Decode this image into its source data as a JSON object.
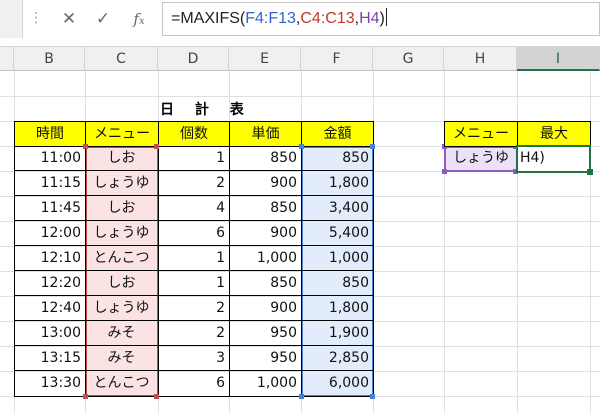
{
  "formula_bar": {
    "cancel_icon": "x-icon",
    "enter_icon": "check-icon",
    "function_icon": "fx-icon",
    "formula_prefix": "=MAXIFS(",
    "arg1": "F4:F13",
    "sep1": ",",
    "arg2": "C4:C13",
    "sep2": ",",
    "arg3": "H4",
    "suffix": ")"
  },
  "columns": [
    "B",
    "C",
    "D",
    "E",
    "F",
    "G",
    "H",
    "I"
  ],
  "selected_column": "I",
  "sheet": {
    "title": "日 計 表",
    "headers": [
      "時間",
      "メニュー",
      "個数",
      "単価",
      "金額"
    ],
    "rows": [
      [
        "11:00",
        "しお",
        "1",
        "850",
        "850"
      ],
      [
        "11:15",
        "しょうゆ",
        "2",
        "900",
        "1,800"
      ],
      [
        "11:45",
        "しお",
        "4",
        "850",
        "3,400"
      ],
      [
        "12:00",
        "しょうゆ",
        "6",
        "900",
        "5,400"
      ],
      [
        "12:10",
        "とんこつ",
        "1",
        "1,000",
        "1,000"
      ],
      [
        "12:20",
        "しお",
        "1",
        "850",
        "850"
      ],
      [
        "12:40",
        "しょうゆ",
        "2",
        "900",
        "1,800"
      ],
      [
        "13:00",
        "みそ",
        "2",
        "950",
        "1,900"
      ],
      [
        "13:15",
        "みそ",
        "3",
        "950",
        "2,850"
      ],
      [
        "13:30",
        "とんこつ",
        "6",
        "1,000",
        "6,000"
      ]
    ]
  },
  "lookup": {
    "headers": [
      "メニュー",
      "最大"
    ],
    "criteria": "しょうゆ",
    "editing_text": "H4)"
  },
  "colors": {
    "header_fill": "#ffff00",
    "range_red": "#c0504d",
    "range_blue": "#4a7fd4",
    "range_purple": "#8e5cc7",
    "selection_green": "#217346"
  }
}
